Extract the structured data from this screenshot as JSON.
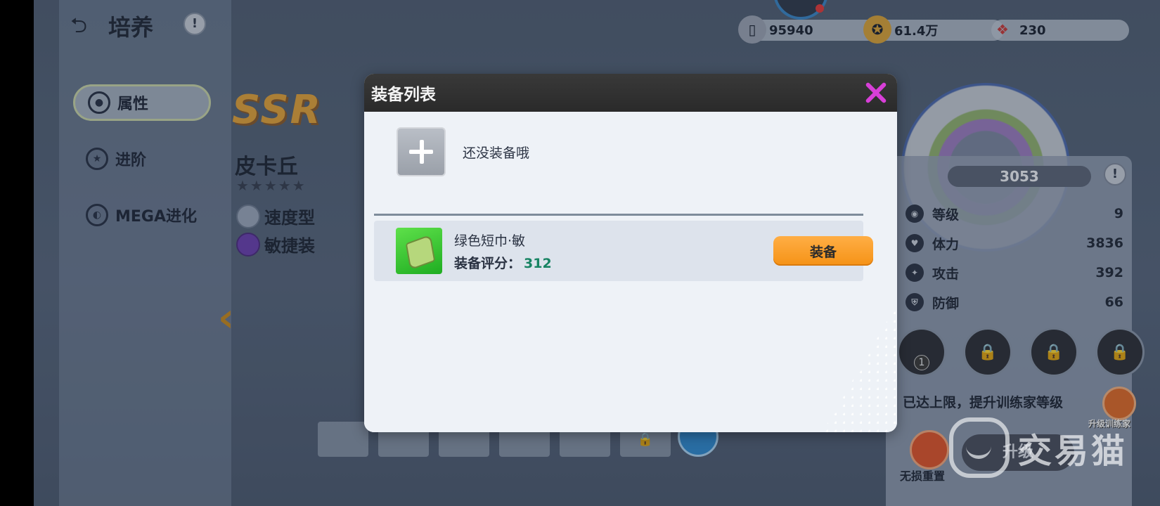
{
  "header": {
    "title": "培养",
    "help": "!"
  },
  "sidebar": {
    "items": [
      {
        "label": "属性",
        "active": true
      },
      {
        "label": "进阶",
        "active": false
      },
      {
        "label": "MEGA进化",
        "active": false
      }
    ]
  },
  "pokemon": {
    "rarity": "SSR",
    "name": "皮卡丘",
    "stars": "★★★★★",
    "type_tag": "速度型",
    "equip_tag": "敏捷装"
  },
  "currency": [
    {
      "icon": "card-icon",
      "value": "95940"
    },
    {
      "icon": "coin-icon",
      "value": "61.4万"
    },
    {
      "icon": "candy-icon",
      "value": "230"
    }
  ],
  "stats_panel": {
    "power": "3053",
    "help": "!",
    "stats": [
      {
        "icon": "level-icon",
        "label": "等级",
        "value": "9"
      },
      {
        "icon": "hp-icon",
        "label": "体力",
        "value": "3836"
      },
      {
        "icon": "attack-icon",
        "label": "攻击",
        "value": "392"
      },
      {
        "icon": "defense-icon",
        "label": "防御",
        "value": "66"
      }
    ],
    "skill_badge": "1",
    "max_tip": "已达上限，提升训练家等级",
    "upgrade_trainer": "升级训练家",
    "reset_label": "无损重置",
    "upgrade_label": "升级"
  },
  "modal": {
    "title": "装备列表",
    "empty_text": "还没装备哦",
    "items": [
      {
        "name": "绿色短巾·敏",
        "score_label": "装备评分：",
        "score": "312",
        "button": "装备"
      }
    ]
  },
  "watermark": {
    "text": "交易猫"
  },
  "colors": {
    "accent_orange": "#f59216",
    "close_pink": "#d83fd8",
    "score_green": "#188463",
    "modal_header": "#2a2a2a"
  }
}
